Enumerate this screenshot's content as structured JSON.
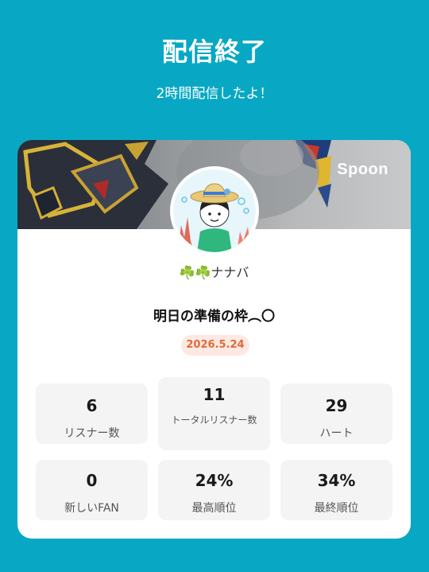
{
  "header": {
    "title": "配信終了",
    "subtitle": "2時間配信したよ！"
  },
  "card": {
    "brand": "Spoon",
    "username_prefix": "☘️☘️",
    "username": "ナナバ",
    "live_title": "明日の準備の枠︵〇",
    "date": "2026.5.24"
  },
  "stats": [
    {
      "value": "6",
      "label": "リスナー数"
    },
    {
      "value": "11",
      "label": "トータルリスナー数"
    },
    {
      "value": "29",
      "label": "ハート"
    },
    {
      "value": "0",
      "label": "新しいFAN"
    },
    {
      "value": "24%",
      "label": "最高順位"
    },
    {
      "value": "34%",
      "label": "最終順位"
    }
  ],
  "colors": {
    "background": "#08a8c4",
    "card": "#ffffff",
    "date_badge_bg": "#fde9e2",
    "date_badge_text": "#e06a3a",
    "stat_bg": "#f4f4f5"
  }
}
